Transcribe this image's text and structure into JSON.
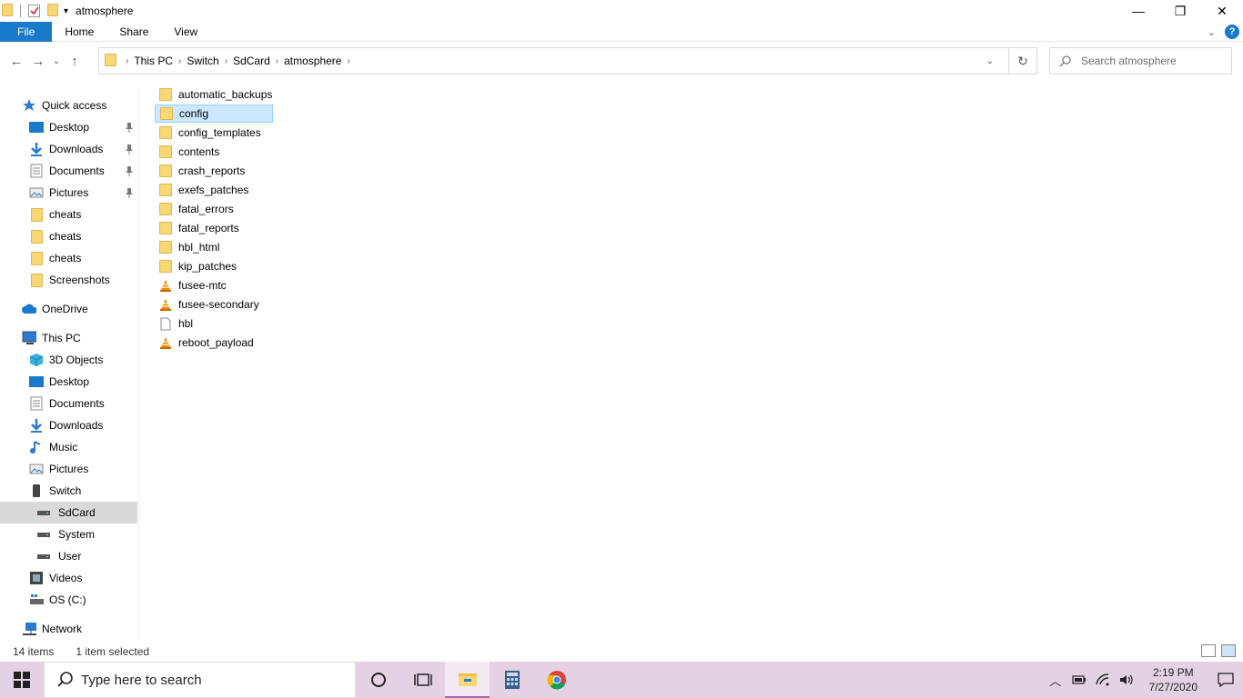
{
  "window": {
    "title": "atmosphere"
  },
  "window_controls": {
    "minimize": "—",
    "restore": "❐",
    "close": "✕"
  },
  "ribbon": {
    "tabs": [
      "File",
      "Home",
      "Share",
      "View"
    ],
    "help": "?"
  },
  "address": {
    "crumbs": [
      "This PC",
      "Switch",
      "SdCard",
      "atmosphere"
    ],
    "search_placeholder": "Search atmosphere"
  },
  "nav": {
    "items": [
      {
        "label": "Quick access",
        "icon": "star-icon",
        "indent": 0,
        "pinned": false,
        "selected": false
      },
      {
        "label": "Desktop",
        "icon": "desktop-icon",
        "indent": 1,
        "pinned": true,
        "selected": false
      },
      {
        "label": "Downloads",
        "icon": "download-icon",
        "indent": 1,
        "pinned": true,
        "selected": false
      },
      {
        "label": "Documents",
        "icon": "documents-icon",
        "indent": 1,
        "pinned": true,
        "selected": false
      },
      {
        "label": "Pictures",
        "icon": "pictures-icon",
        "indent": 1,
        "pinned": true,
        "selected": false
      },
      {
        "label": "cheats",
        "icon": "folder-icon",
        "indent": 1,
        "pinned": false,
        "selected": false
      },
      {
        "label": "cheats",
        "icon": "folder-icon",
        "indent": 1,
        "pinned": false,
        "selected": false
      },
      {
        "label": "cheats",
        "icon": "folder-icon",
        "indent": 1,
        "pinned": false,
        "selected": false
      },
      {
        "label": "Screenshots",
        "icon": "folder-icon",
        "indent": 1,
        "pinned": false,
        "selected": false
      },
      {
        "label": "OneDrive",
        "icon": "cloud-icon",
        "indent": 0,
        "pinned": false,
        "selected": false
      },
      {
        "label": "This PC",
        "icon": "computer-icon",
        "indent": 0,
        "pinned": false,
        "selected": false
      },
      {
        "label": "3D Objects",
        "icon": "cube-icon",
        "indent": 1,
        "pinned": false,
        "selected": false
      },
      {
        "label": "Desktop",
        "icon": "desktop-icon",
        "indent": 1,
        "pinned": false,
        "selected": false
      },
      {
        "label": "Documents",
        "icon": "documents-icon",
        "indent": 1,
        "pinned": false,
        "selected": false
      },
      {
        "label": "Downloads",
        "icon": "download-icon",
        "indent": 1,
        "pinned": false,
        "selected": false
      },
      {
        "label": "Music",
        "icon": "music-icon",
        "indent": 1,
        "pinned": false,
        "selected": false
      },
      {
        "label": "Pictures",
        "icon": "pictures-icon",
        "indent": 1,
        "pinned": false,
        "selected": false
      },
      {
        "label": "Switch",
        "icon": "device-icon",
        "indent": 1,
        "pinned": false,
        "selected": false
      },
      {
        "label": "SdCard",
        "icon": "drive-icon",
        "indent": 2,
        "pinned": false,
        "selected": true
      },
      {
        "label": "System",
        "icon": "drive-icon",
        "indent": 2,
        "pinned": false,
        "selected": false
      },
      {
        "label": "User",
        "icon": "drive-icon",
        "indent": 2,
        "pinned": false,
        "selected": false
      },
      {
        "label": "Videos",
        "icon": "video-icon",
        "indent": 1,
        "pinned": false,
        "selected": false
      },
      {
        "label": "OS (C:)",
        "icon": "os-drive-icon",
        "indent": 1,
        "pinned": false,
        "selected": false
      },
      {
        "label": "Network",
        "icon": "network-icon",
        "indent": 0,
        "pinned": false,
        "selected": false
      }
    ]
  },
  "files": [
    {
      "name": "automatic_backups",
      "type": "folder",
      "selected": false
    },
    {
      "name": "config",
      "type": "folder",
      "selected": true
    },
    {
      "name": "config_templates",
      "type": "folder",
      "selected": false
    },
    {
      "name": "contents",
      "type": "folder",
      "selected": false
    },
    {
      "name": "crash_reports",
      "type": "folder",
      "selected": false
    },
    {
      "name": "exefs_patches",
      "type": "folder",
      "selected": false
    },
    {
      "name": "fatal_errors",
      "type": "folder",
      "selected": false
    },
    {
      "name": "fatal_reports",
      "type": "folder",
      "selected": false
    },
    {
      "name": "hbl_html",
      "type": "folder",
      "selected": false
    },
    {
      "name": "kip_patches",
      "type": "folder",
      "selected": false
    },
    {
      "name": "fusee-mtc",
      "type": "vlc",
      "selected": false
    },
    {
      "name": "fusee-secondary",
      "type": "vlc",
      "selected": false
    },
    {
      "name": "hbl",
      "type": "file",
      "selected": false
    },
    {
      "name": "reboot_payload",
      "type": "vlc",
      "selected": false
    }
  ],
  "status": {
    "count": "14 items",
    "selection": "1 item selected"
  },
  "taskbar": {
    "search_placeholder": "Type here to search",
    "time": "2:19 PM",
    "date": "7/27/2020"
  },
  "colors": {
    "accent": "#1979ca",
    "folder": "#f8d775",
    "selection": "#cce8ff",
    "taskbar": "#e4d2e4"
  }
}
